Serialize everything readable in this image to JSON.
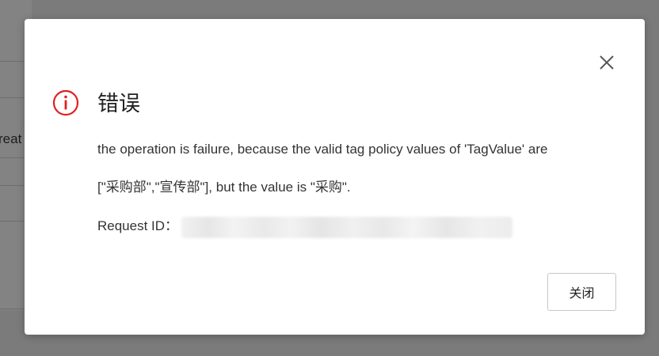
{
  "background": {
    "partial_text": "reat"
  },
  "dialog": {
    "title": "错误",
    "message_line1": "the operation is failure, because the valid tag policy values of 'TagValue' are",
    "message_line2": "[\"采购部\",\"宣传部\"], but the value is \"采购\".",
    "request_id_label": "Request ID：",
    "close_button_label": "关闭",
    "icons": {
      "status": "error-circle-icon",
      "close": "close-icon"
    },
    "colors": {
      "error": "#e02020",
      "text": "#333333",
      "title": "#222222"
    }
  }
}
